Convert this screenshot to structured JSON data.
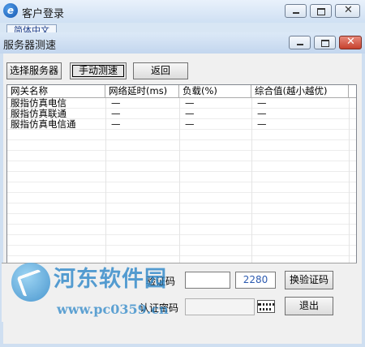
{
  "outer_window": {
    "title": "客户登录",
    "tab_label": "简体中文"
  },
  "dialog": {
    "title": "服务器测速",
    "buttons": {
      "select_server": "选择服务器",
      "manual_speedtest": "手动测速",
      "back": "返回"
    },
    "table": {
      "columns": [
        "网关名称",
        "网络延时(ms)",
        "负载(%)",
        "综合值(越小越优)"
      ],
      "rows": [
        [
          "服指仿真电信",
          "—",
          "—",
          "—"
        ],
        [
          "服指仿真联通",
          "—",
          "—",
          "—"
        ],
        [
          "服指仿真电信通",
          "—",
          "—",
          "—"
        ]
      ]
    }
  },
  "login_panel": {
    "captcha_label": "验证码",
    "captcha_input_value": "",
    "captcha_value": "2280",
    "refresh_captcha_button": "换验证码",
    "auth_password_label": "认证密码",
    "auth_password_value": "",
    "exit_button": "退出"
  },
  "watermark": {
    "text": "河东软件园",
    "url": "www.pc0359.cn"
  },
  "colors": {
    "close_button": "#c6412d",
    "captcha_text": "#2c5ab0",
    "watermark": "#2d87c9"
  }
}
